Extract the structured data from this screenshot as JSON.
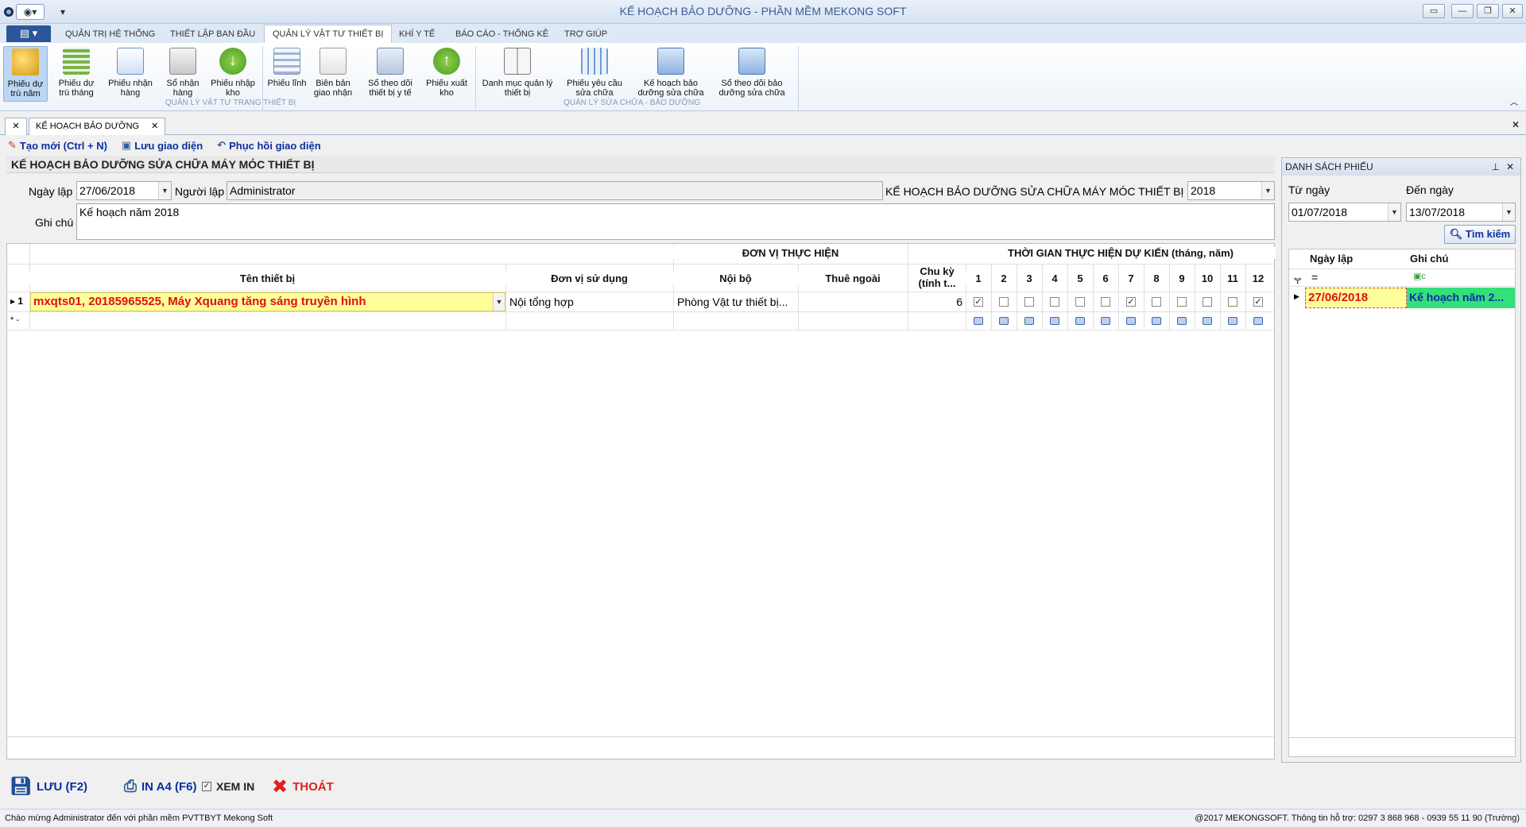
{
  "window": {
    "title": "KẾ HOẠCH BẢO DƯỠNG - PHẦN MỀM MEKONG SOFT"
  },
  "ribbon_tabs": [
    {
      "label": "QUẢN TRỊ HỆ THỐNG"
    },
    {
      "label": "THIẾT LẬP BAN ĐẦU"
    },
    {
      "label": "QUẢN LÝ VẬT TƯ THIẾT BỊ"
    },
    {
      "label": "KHÍ Y TẾ"
    },
    {
      "label": "BÁO CÁO - THỐNG KÊ"
    },
    {
      "label": "TRỢ GIÚP"
    }
  ],
  "ribbon": {
    "buttons": [
      {
        "label": "Phiếu dự trù năm",
        "icon": "coins-icon"
      },
      {
        "label": "Phiếu dự trù tháng",
        "icon": "grid-icon"
      },
      {
        "label": "Phiếu nhận hàng",
        "icon": "sheet-icon"
      },
      {
        "label": "Sổ nhận hàng",
        "icon": "book-icon"
      },
      {
        "label": "Phiếu nhập kho",
        "icon": "arrow-down-icon"
      },
      {
        "label": "Phiếu lĩnh",
        "icon": "form-icon"
      },
      {
        "label": "Biên bản giao nhận",
        "icon": "document-icon"
      },
      {
        "label": "Sổ theo dõi thiết bị y tế",
        "icon": "ledger-icon"
      },
      {
        "label": "Phiếu xuất kho",
        "icon": "arrow-up-icon"
      },
      {
        "label": "Danh mục quản lý thiết bị",
        "icon": "open-book-icon"
      },
      {
        "label": "Phiếu yêu cầu sửa chữa",
        "icon": "table-icon"
      },
      {
        "label": "Kế hoạch bảo dưỡng sửa chữa",
        "icon": "plan-icon"
      },
      {
        "label": "Sổ theo dõi bảo dưỡng sửa chữa",
        "icon": "log-icon"
      }
    ],
    "group1": "QUẢN LÝ VẬT TƯ TRANG THIẾT BỊ",
    "group2": "QUẢN LÝ SỬA CHỮA - BẢO DƯỠNG"
  },
  "doc_tab": "KẾ HOẠCH BẢO DƯỠNG",
  "toolbar": {
    "new": "Tạo mới (Ctrl + N)",
    "save_layout": "Lưu giao diện",
    "restore_layout": "Phục hồi giao diện"
  },
  "form": {
    "title": "KẾ HOẠCH BẢO DƯỠNG SỬA CHỮA MÁY MÓC THIẾT BỊ",
    "date_label": "Ngày lập",
    "date_value": "27/06/2018",
    "creator_label": "Người lập",
    "creator_value": "Administrator",
    "year_label": "KẾ HOẠCH BẢO DƯỠNG SỬA CHỮA MÁY MÓC THIẾT BỊ NĂM:",
    "year_value": "2018",
    "note_label": "Ghi chú",
    "note_value": "Kế hoạch năm 2018"
  },
  "grid": {
    "group_unit": "ĐƠN VỊ THỰC HIỆN",
    "group_time": "THỜI GIAN THỰC HIỆN DỰ KIẾN (tháng, năm)",
    "columns": {
      "device": "Tên thiết bị",
      "user_unit": "Đơn vị sử dụng",
      "internal": "Nội bộ",
      "external": "Thuê ngoài",
      "cycle": "Chu kỳ (tính t..."
    },
    "months": [
      "1",
      "2",
      "3",
      "4",
      "5",
      "6",
      "7",
      "8",
      "9",
      "10",
      "11",
      "12"
    ],
    "rows": [
      {
        "index": "1",
        "device": "mxqts01, 20185965525, Máy Xquang tăng sáng truyền hình",
        "user_unit": "Nội tổng hợp",
        "internal": "Phòng Vật tư thiết bị...",
        "external": "",
        "cycle": "6",
        "checked": [
          true,
          false,
          false,
          false,
          false,
          false,
          true,
          false,
          false,
          false,
          false,
          true
        ]
      }
    ],
    "new_row_marker": "* -"
  },
  "side_panel": {
    "title": "DANH SÁCH PHIẾU",
    "from_label": "Từ ngày",
    "from_value": "01/07/2018",
    "to_label": "Đến ngày",
    "to_value": "13/07/2018",
    "search_label": "Tìm kiếm",
    "col_date": "Ngày lập",
    "col_note": "Ghi chú",
    "filter_eq": "=",
    "rows": [
      {
        "date": "27/06/2018",
        "note": "Kế hoạch năm 2..."
      }
    ]
  },
  "actions": {
    "save": "LƯU (F2)",
    "print": "IN A4 (F6)",
    "preview": "XEM IN",
    "exit": "THOÁT"
  },
  "status": {
    "left": "Chào mừng Administrator đến với phần mềm PVTTBYT Mekong Soft",
    "right": "@2017 MEKONGSOFT. Thông tin hỗ trợ: 0297 3 868 968 - 0939 55 11 90 (Trường)"
  },
  "colors": {
    "accent": "#2b579a",
    "row_highlight": "#ffff99",
    "device_text": "#e01010",
    "note_cell": "#33e07a"
  }
}
